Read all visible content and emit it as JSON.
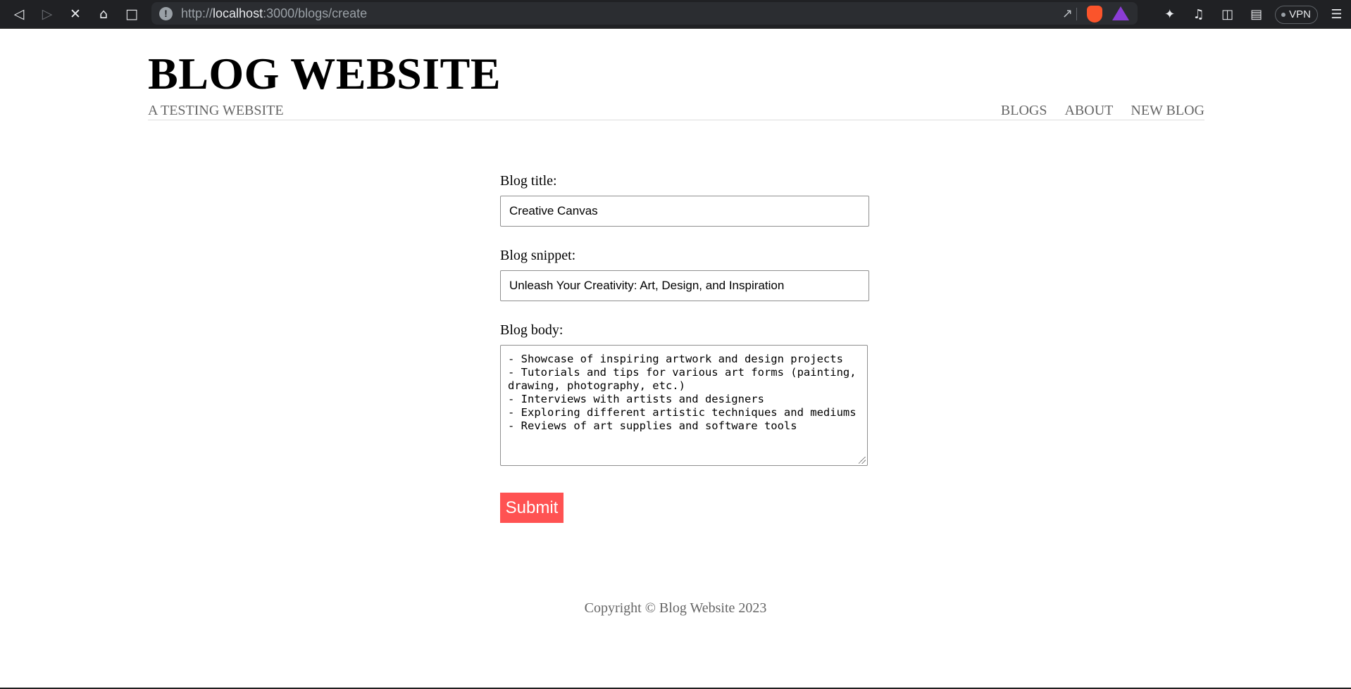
{
  "browser": {
    "url_scheme": "http://",
    "url_host": "localhost",
    "url_path": ":3000/blogs/create",
    "vpn_label": "VPN",
    "icons": [
      "back-icon",
      "forward-icon",
      "stop-icon",
      "home-icon",
      "bookmark-icon",
      "info-icon",
      "share-icon",
      "brave-shields-icon",
      "brave-rewards-icon",
      "extensions-icon",
      "playlist-icon",
      "sidebar-icon",
      "wallet-icon",
      "menu-icon"
    ]
  },
  "site": {
    "title": "BLOG WEBSITE",
    "subtitle": "A TESTING WEBSITE",
    "nav": [
      "BLOGS",
      "ABOUT",
      "NEW BLOG"
    ]
  },
  "form": {
    "title_label": "Blog title:",
    "title_value": "Creative Canvas",
    "snippet_label": "Blog snippet:",
    "snippet_value": "Unleash Your Creativity: Art, Design, and Inspiration",
    "body_label": "Blog body:",
    "body_value": "- Showcase of inspiring artwork and design projects\n- Tutorials and tips for various art forms (painting, drawing, photography, etc.)\n- Interviews with artists and designers\n- Exploring different artistic techniques and mediums\n- Reviews of art supplies and software tools",
    "submit_label": "Submit"
  },
  "footer": {
    "copyright": "Copyright © Blog Website 2023"
  },
  "colors": {
    "accent": "#ff5252",
    "muted_text": "#666666",
    "chrome_bg": "#202124"
  }
}
